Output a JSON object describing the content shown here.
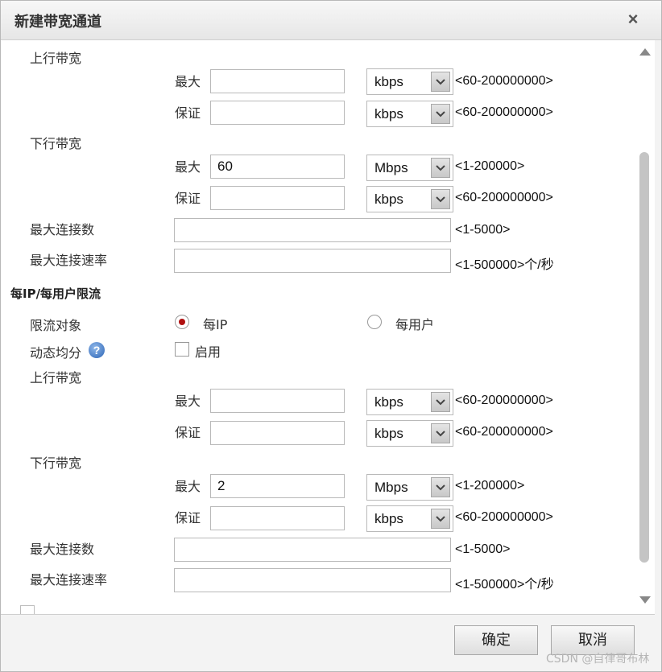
{
  "dialog": {
    "title": "新建带宽通道",
    "close_symbol": "×"
  },
  "section1": {
    "upstream": {
      "label": "上行带宽",
      "max": {
        "label": "最大",
        "value": "",
        "unit": "kbps",
        "range": "<60-200000000>"
      },
      "guarantee": {
        "label": "保证",
        "value": "",
        "unit": "kbps",
        "range": "<60-200000000>"
      }
    },
    "downstream": {
      "label": "下行带宽",
      "max": {
        "label": "最大",
        "value": "60",
        "unit": "Mbps",
        "range": "<1-200000>"
      },
      "guarantee": {
        "label": "保证",
        "value": "",
        "unit": "kbps",
        "range": "<60-200000000>"
      }
    },
    "max_connections": {
      "label": "最大连接数",
      "value": "",
      "range": "<1-5000>"
    },
    "max_connection_rate": {
      "label": "最大连接速率",
      "value": "",
      "range": "<1-500000>个/秒"
    }
  },
  "per_ip": {
    "heading": "每IP/每用户限流",
    "target": {
      "label": "限流对象",
      "options": [
        "每IP",
        "每用户"
      ],
      "selected": "每IP"
    },
    "dynamic_share": {
      "label": "动态均分",
      "help_symbol": "?",
      "checkbox_label": "启用",
      "checked": false
    },
    "upstream": {
      "label": "上行带宽",
      "max": {
        "label": "最大",
        "value": "",
        "unit": "kbps",
        "range": "<60-200000000>"
      },
      "guarantee": {
        "label": "保证",
        "value": "",
        "unit": "kbps",
        "range": "<60-200000000>"
      }
    },
    "downstream": {
      "label": "下行带宽",
      "max": {
        "label": "最大",
        "value": "2",
        "unit": "Mbps",
        "range": "<1-200000>"
      },
      "guarantee": {
        "label": "保证",
        "value": "",
        "unit": "kbps",
        "range": "<60-200000000>"
      }
    },
    "max_connections": {
      "label": "最大连接数",
      "value": "",
      "range": "<1-5000>"
    },
    "max_connection_rate": {
      "label": "最大连接速率",
      "value": "",
      "range": "<1-500000>个/秒"
    }
  },
  "footer": {
    "ok_label": "确定",
    "cancel_label": "取消"
  },
  "watermark": "CSDN @自律哥布林"
}
